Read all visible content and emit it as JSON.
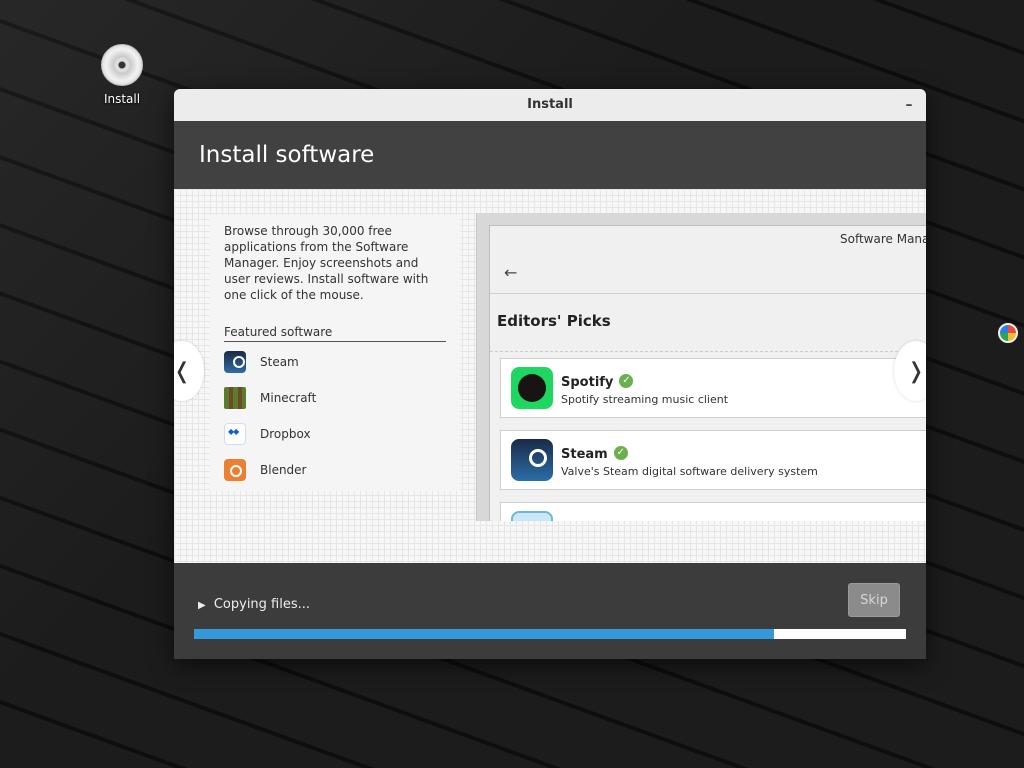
{
  "desktop": {
    "icon_label": "Install"
  },
  "window": {
    "title": "Install",
    "minimize_symbol": "–"
  },
  "header": {
    "title": "Install software"
  },
  "slide": {
    "description": "Browse through 30,000 free applications from the Software Manager. Enjoy screenshots and user reviews. Install software with one click of the mouse.",
    "featured_title": "Featured software",
    "apps": [
      {
        "label": "Steam",
        "icon": "steam-icon"
      },
      {
        "label": "Minecraft",
        "icon": "minecraft-icon"
      },
      {
        "label": "Dropbox",
        "icon": "dropbox-icon"
      },
      {
        "label": "Blender",
        "icon": "blender-icon"
      }
    ],
    "prev_symbol": "❬",
    "next_symbol": "❭"
  },
  "preview": {
    "window_title": "Software Manager",
    "back_symbol": "←",
    "section_title": "Editors' Picks",
    "cards": [
      {
        "name": "Spotify",
        "desc": "Spotify streaming music client",
        "icon": "spotify-icon"
      },
      {
        "name": "Steam",
        "desc": "Valve's Steam digital software delivery system",
        "icon": "steam-icon"
      },
      {
        "name": "",
        "desc": "",
        "icon": "app-icon"
      }
    ]
  },
  "footer": {
    "status": "Copying files...",
    "skip_label": "Skip",
    "progress": 0.815
  },
  "colors": {
    "progress": "#3498db",
    "window_bg": "#3c3c3c",
    "titlebar": "#ececec"
  }
}
